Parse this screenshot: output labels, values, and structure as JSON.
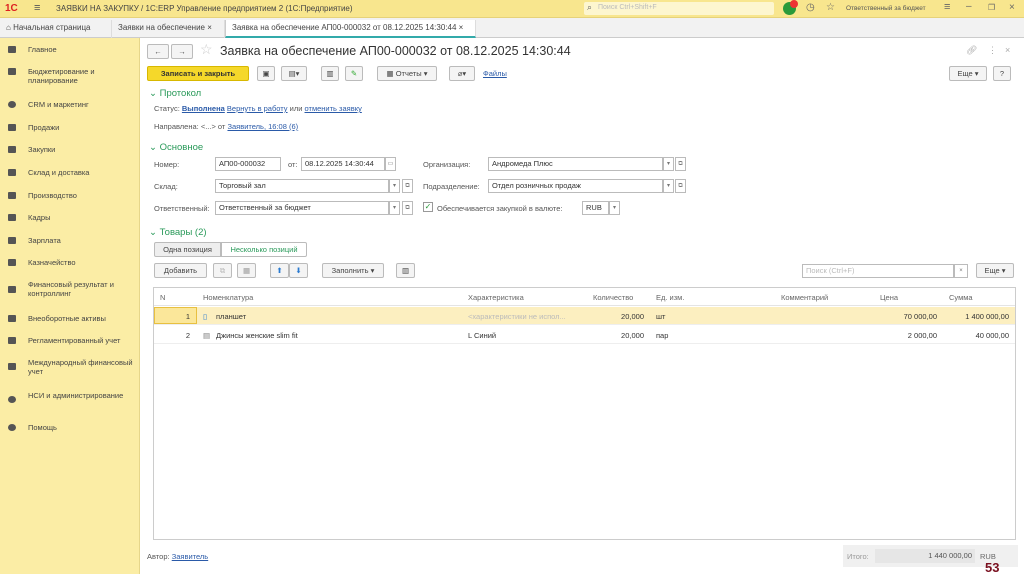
{
  "app": {
    "logo": "1С",
    "title": "ЗАЯВКИ НА ЗАКУПКУ / 1С:ERP Управление предприятием 2  (1С:Предприятие)",
    "search_placeholder": "Поиск Ctrl+Shift+F",
    "notifications": "",
    "user": "Ответственный за бюджет"
  },
  "tabs": [
    {
      "label": "Начальная страница"
    },
    {
      "label": "Заявки на обеспечение"
    },
    {
      "label": "Заявка на обеспечение АП00-000032 от 08.12.2025 14:30:44"
    }
  ],
  "sidebar": {
    "items": [
      {
        "label": "Главное"
      },
      {
        "label": "Бюджетирование и планирование"
      },
      {
        "label": "CRM и маркетинг"
      },
      {
        "label": "Продажи"
      },
      {
        "label": "Закупки"
      },
      {
        "label": "Склад и доставка"
      },
      {
        "label": "Производство"
      },
      {
        "label": "Кадры"
      },
      {
        "label": "Зарплата"
      },
      {
        "label": "Казначейство"
      },
      {
        "label": "Финансовый результат и контроллинг"
      },
      {
        "label": "Внеоборотные активы"
      },
      {
        "label": "Регламентированный учет"
      },
      {
        "label": "Международный финансовый учет"
      },
      {
        "label": "НСИ и администрирование"
      },
      {
        "label": "Помощь"
      }
    ]
  },
  "form": {
    "title": "Заявка на обеспечение АП00-000032 от 08.12.2025 14:30:44",
    "toolbar": {
      "save_close": "Записать и закрыть",
      "reports": "Отчеты",
      "files": "Файлы",
      "more": "Еще",
      "help": "?"
    },
    "protocol": {
      "header": "Протокол",
      "status_label": "Статус:",
      "status": "Выполнена",
      "return_link": "Вернуть в работу",
      "or": "или",
      "cancel_link": "отменить заявку",
      "sent_label": "Направлена: <...> от",
      "sent_link": "Заявитель, 16:08 (6)"
    },
    "main": {
      "header": "Основное",
      "number_label": "Номер:",
      "number": "АП00-000032",
      "date_label": "от:",
      "date": "08.12.2025 14:30:44",
      "org_label": "Организация:",
      "org": "Андромеда Плюс",
      "warehouse_label": "Склад:",
      "warehouse": "Торговый зал",
      "dept_label": "Подразделение:",
      "dept": "Отдел розничных продаж",
      "resp_label": "Ответственный:",
      "resp": "Ответственный за бюджет",
      "currency_check_label": "Обеспечивается закупкой в валюте:",
      "currency_checked": true,
      "currency": "RUB"
    },
    "goods": {
      "header": "Товары (2)",
      "mode_one": "Одна позиция",
      "mode_many": "Несколько позиций",
      "add": "Добавить",
      "fill": "Заполнить",
      "search_placeholder": "Поиск (Ctrl+F)",
      "more": "Еще",
      "columns": [
        "N",
        "Номенклатура",
        "Характеристика",
        "Количество",
        "Ед. изм.",
        "Комментарий",
        "Цена",
        "Сумма"
      ],
      "rows": [
        {
          "n": "1",
          "item": "планшет",
          "char": "<характеристики не испол...",
          "qty": "20,000",
          "unit": "шт",
          "comment": "",
          "price": "70 000,00",
          "sum": "1 400 000,00"
        },
        {
          "n": "2",
          "item": "Джинсы женские slim fit",
          "char": "L Синий",
          "qty": "20,000",
          "unit": "пар",
          "comment": "",
          "price": "2 000,00",
          "sum": "40 000,00"
        }
      ]
    },
    "footer": {
      "author_label": "Автор:",
      "author": "Заявитель",
      "total_label": "Итого:",
      "total": "1 440 000,00",
      "currency": "RUB"
    }
  },
  "slide_number": "53",
  "colors": {
    "titlebar": "#f8e68e",
    "sidebar": "#fbeda5",
    "accent_green": "#2a9a5a",
    "primary_button": "#f5d82a",
    "selected_row": "#fcefc0",
    "slide_number": "#7a1020"
  }
}
